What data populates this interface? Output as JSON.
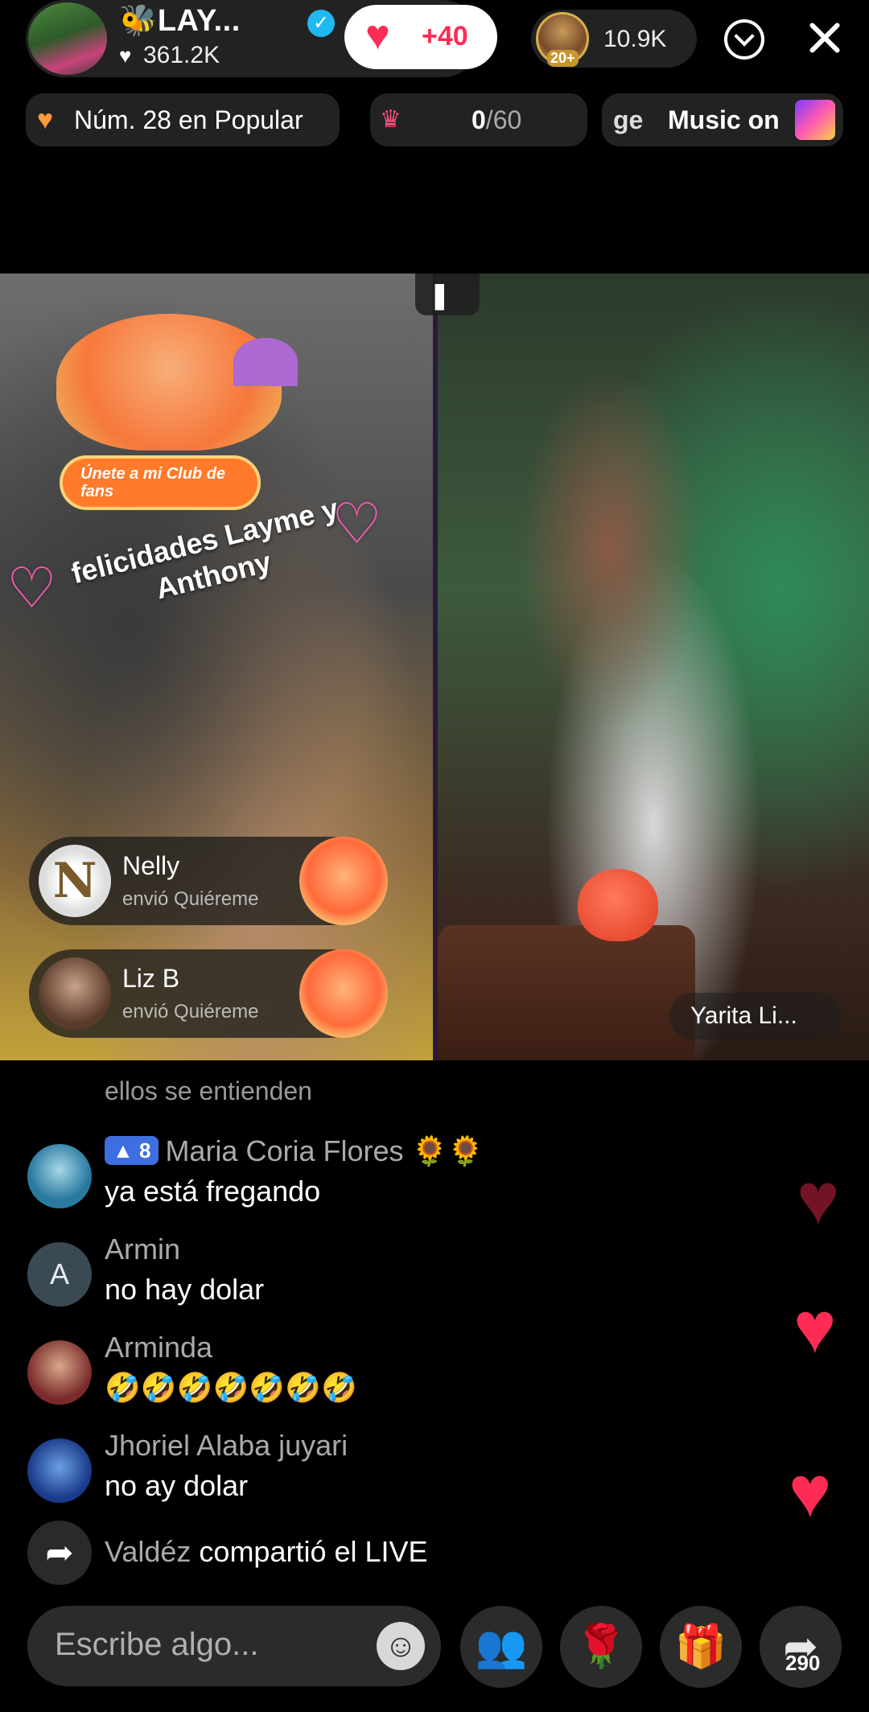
{
  "header": {
    "host_name": "🐝LAY...",
    "host_likes": "361.2K",
    "like_button": "+40",
    "viewer_badge": "20+",
    "viewer_count": "10.9K"
  },
  "pills": {
    "rank": "Núm. 28 en Popular",
    "goal_current": "0",
    "goal_total": "/60",
    "music_prefix": "ge",
    "music": "Music on"
  },
  "stream": {
    "fan_club_button": "Únete a mi Club de fans",
    "overlay_text": "felicidades Layme y Anthony",
    "guest_name": "Yarita Li...",
    "gift_notifications": [
      {
        "name": "Nelly",
        "action": "envió Quiéreme",
        "initial": "N"
      },
      {
        "name": "Liz B",
        "action": "envió Quiéreme"
      }
    ]
  },
  "comments": {
    "faded": "ellos se entienden",
    "items": [
      {
        "level": "8",
        "name": "Maria Coria Flores 🌻🌻",
        "message": "ya está fregando"
      },
      {
        "name": "Armin",
        "initial": "A",
        "message": "no hay dolar"
      },
      {
        "name": "Arminda",
        "message": "🤣🤣🤣🤣🤣🤣🤣"
      },
      {
        "name": "Jhoriel Alaba juyari",
        "message": "no ay dolar"
      }
    ],
    "share_user": "Valdéz",
    "share_text": "compartió el LIVE"
  },
  "bottom": {
    "input_placeholder": "Escribe algo...",
    "share_count": "290"
  },
  "colors": {
    "accent": "#fe2c55",
    "level_badge": "#3d6fe0",
    "verified": "#20b9ef"
  }
}
